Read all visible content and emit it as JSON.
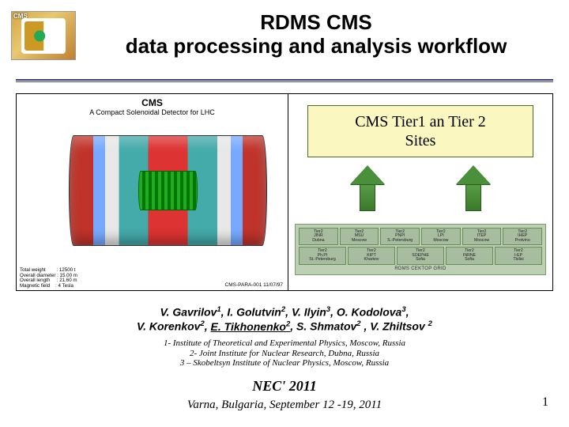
{
  "logo": {
    "text": "CMS"
  },
  "title": {
    "line1": "RDMS CMS",
    "line2": "data processing and analysis workflow"
  },
  "detector": {
    "heading": "CMS",
    "sub": "A Compact Solenoidal Detector for LHC",
    "meta": "Total weight        : 12500 t\nOverall diameter : 15.00 m\nOverall length     : 21.60 m\nMagnetic field    : 4 Tesla",
    "id": "CMS-PARA-001  11/07/97"
  },
  "tier_box": {
    "line1": "CMS Tier1 an Tier 2",
    "line2": "Sites"
  },
  "grid": {
    "row1": [
      "Tier2\nJINR\nDubna",
      "Tier2\nMSU\nMoscow",
      "Tier2\nPNPI\nS.-Petersburg",
      "Tier2\nLPI\nMoscow",
      "Tier2\nITEP\nMoscow",
      "Tier2\nIHEP\nProtvino"
    ],
    "row2": [
      "Tier2\nPh.PI\nSt.-Petersburg",
      "Tier2\nKIPT\nKharkov",
      "Tier2\nSOEPHE\nSofia",
      "Tier2\nINRNE\nSofia",
      "Tier2\nI-EP\nTbilisi"
    ],
    "label": "RDMS CEKTOP GRID"
  },
  "authors_html": "V. Gavrilov<sup>1</sup>, I. Golutvin<sup>2</sup>, V. Ilyin<sup>3</sup>, O. Kodolova<sup>3</sup>,<br>V. Korenkov<sup>2</sup>, <span class=\"u\">E. Tikhonenko<sup>2</sup></span>, S. Shmatov<sup>2</sup> , V. Zhiltsov <sup>2</sup>",
  "affil": {
    "a1": "1- Institute of Theoretical and Experimental Physics, Moscow, Russia",
    "a2": "2- Joint Institute for Nuclear Research, Dubna, Russia",
    "a3": "3 – Skobeltsyn Institute of Nuclear Physics, Moscow, Russia"
  },
  "conference": "NEC' 2011",
  "venue": "Varna, Bulgaria, September 12 -19, 2011",
  "page": "1"
}
